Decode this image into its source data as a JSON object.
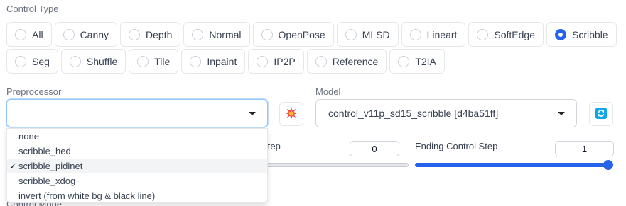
{
  "control_type": {
    "label": "Control Type",
    "options_row1": [
      "All",
      "Canny",
      "Depth",
      "Normal",
      "OpenPose",
      "MLSD",
      "Lineart",
      "SoftEdge",
      "Scribble"
    ],
    "options_row2": [
      "Seg",
      "Shuffle",
      "Tile",
      "Inpaint",
      "IP2P",
      "Reference",
      "T2IA"
    ],
    "selected": "Scribble"
  },
  "preprocessor": {
    "label": "Preprocessor",
    "value": "",
    "options": [
      "none",
      "scribble_hed",
      "scribble_pidinet",
      "scribble_xdog",
      "invert (from white bg & black line)"
    ],
    "selected": "scribble_pidinet",
    "check_mark": "✓"
  },
  "model": {
    "label": "Model",
    "value": "control_v11p_sd15_scribble [d4ba51ff]"
  },
  "starting_step": {
    "label_partial": "rol Step",
    "value": "0"
  },
  "ending_step": {
    "label": "Ending Control Step",
    "value": "1"
  },
  "control_mode_label_partial": "Control Mode",
  "icons": {
    "run_preprocessor": "explosion-icon",
    "refresh_models": "refresh-icon"
  },
  "colors": {
    "accent": "#2563eb",
    "track_bg": "#e5e7eb"
  }
}
